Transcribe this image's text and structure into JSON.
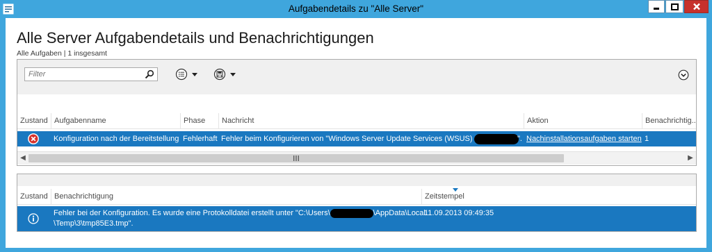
{
  "window": {
    "title": "Aufgabendetails zu \"Alle Server\""
  },
  "page": {
    "title": "Alle Server Aufgabendetails und Benachrichtigungen",
    "subtitle": "Alle Aufgaben | 1 insgesamt"
  },
  "tasks": {
    "filter_placeholder": "Filter",
    "columns": [
      "Zustand",
      "Aufgabenname",
      "Phase",
      "Nachricht",
      "Aktion",
      "Benachrichtig..."
    ],
    "rows": [
      {
        "status_icon": "error-icon",
        "name": "Konfiguration nach der Bereitstellung",
        "phase": "Fehlerhaft",
        "message": "Fehler beim Konfigurieren von \"Windows Server Update Services (WSUS)\" auf",
        "message_end": "\".",
        "action": "Nachinstallationsaufgaben starten",
        "notifications": "1"
      }
    ]
  },
  "notifications": {
    "columns": [
      "Zustand",
      "Benachrichtigung",
      "Zeitstempel"
    ],
    "rows": [
      {
        "status_icon": "info-icon",
        "text_line1_a": "Fehler bei der Konfiguration. Es wurde eine Protokolldatei erstellt unter \"C:\\Users\\",
        "text_line1_b": "\\AppData\\Local",
        "text_line2": "\\Temp\\3\\tmp85E3.tmp\".",
        "timestamp": "11.09.2013 09:49:35"
      }
    ]
  },
  "colors": {
    "titlebar": "#3fa6dd",
    "selection": "#1a78c0",
    "close": "#c7312c"
  }
}
